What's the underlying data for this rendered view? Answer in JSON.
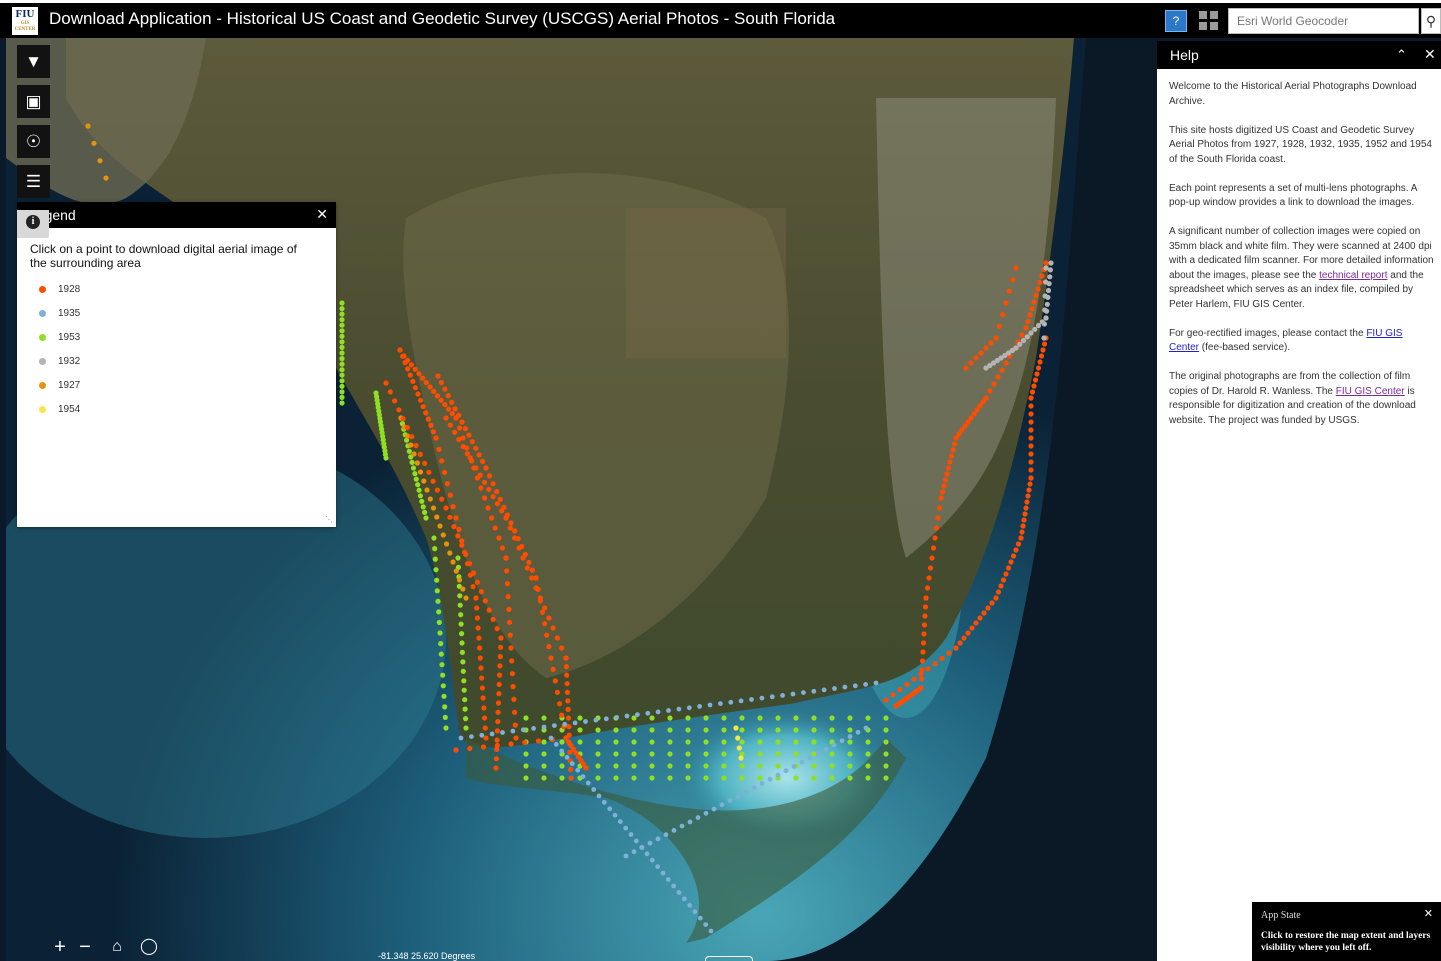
{
  "header": {
    "logo_text": "FIU",
    "logo_subtext": "GIS CENTER",
    "title": "Download Application - Historical US Coast and Geodetic Survey (USCGS) Aerial Photos - South Florida",
    "search_placeholder": "Esri World Geocoder",
    "help_icon": "help-icon",
    "grid_icon": "apps-grid-icon"
  },
  "toolbar": {
    "filter_icon": "filter-icon",
    "select_icon": "select-icon",
    "location_icon": "location-icon",
    "list_icon": "layer-list-icon"
  },
  "legend": {
    "title": "Legend",
    "description": "Click on a point to download digital aerial image of the surrounding area",
    "items": [
      {
        "label": "1928",
        "color": "#ff4d00"
      },
      {
        "label": "1935",
        "color": "#7fb0d8"
      },
      {
        "label": "1953",
        "color": "#8fe024"
      },
      {
        "label": "1932",
        "color": "#b4b4b4"
      },
      {
        "label": "1927",
        "color": "#e6920c"
      },
      {
        "label": "1954",
        "color": "#f7e64a"
      }
    ]
  },
  "help": {
    "title": "Help",
    "p1": "Welcome to the Historical Aerial Photographs Download Archive.",
    "p2": "This site hosts digitized US Coast and Geodetic Survey Aerial Photos from 1927, 1928, 1932, 1935, 1952 and 1954 of the South Florida coast.",
    "p3": "Each point represents a set of multi-lens photographs. A pop-up window provides a link to download the images.",
    "p4_pre": "A significant number of collection images were copied on 35mm black and white film. They were scanned at 2400 dpi with a dedicated film scanner. For more detailed information about the images, please see the ",
    "p4_link": "technical report",
    "p4_post": " and the spreadsheet which serves as an index file, compiled by Peter Harlem, FIU GIS Center.",
    "p5_pre": "For geo-rectified images, please contact the ",
    "p5_link": "FIU GIS Center",
    "p5_post": " (fee-based service).",
    "p6_pre": "The original photographs are from the collection of film copies of Dr. Harold R. Wanless. The ",
    "p6_link": "FIU GIS Center",
    "p6_post": " is responsible for digitization and creation of the download website. The project was funded by USGS."
  },
  "app_state": {
    "title": "App State",
    "message": "Click to restore the map extent and layers visibility where you left off."
  },
  "map": {
    "zoom_in": "+",
    "zoom_out": "−",
    "coordinates": "-81.348 25.620 Degrees"
  }
}
